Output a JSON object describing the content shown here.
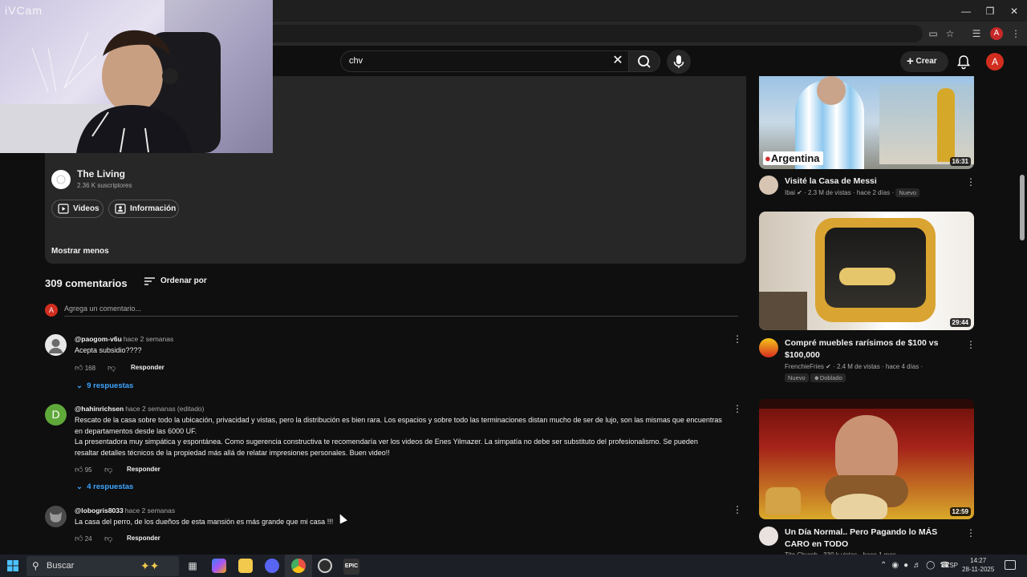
{
  "webcam": {
    "label": "iVCam"
  },
  "browser": {
    "profile_initial": "A"
  },
  "header": {
    "search_value": "chv",
    "create_label": "Crear",
    "avatar_initial": "A"
  },
  "description": {
    "channel_name": "The Living",
    "channel_subs": "2.36 K suscriptores",
    "videos_label": "Videos",
    "info_label": "Información",
    "show_less": "Mostrar menos"
  },
  "comments": {
    "count": "309 comentarios",
    "sort_label": "Ordenar por",
    "my_initial": "A",
    "placeholder": "Agrega un comentario...",
    "items": [
      {
        "author": "@paogom-v6u",
        "time": "hace 2 semanas",
        "text": [
          "Acepta subsidio????"
        ],
        "likes": "168",
        "reply_label": "Responder",
        "replies": "9 respuestas"
      },
      {
        "author": "@hahinrichsen",
        "time": "hace 2 semanas (editado)",
        "avatar_initial": "D",
        "text": [
          "Rescato de la casa sobre todo la ubicación, privacidad y vistas, pero la distribución es bien rara. Los espacios y sobre todo las terminaciones distan mucho de ser de lujo, son las mismas que encuentras",
          "en departamentos desde las 6000 UF.",
          "La presentadora muy simpática y espontánea. Como sugerencia constructiva te recomendaría ver los videos de Enes Yilmazer. La simpatía no debe ser substituto del profesionalismo. Se pueden",
          "resaltar detalles técnicos de la propiedad más allá de relatar impresiones personales. Buen video!!"
        ],
        "likes": "95",
        "reply_label": "Responder",
        "replies": "4 respuestas"
      },
      {
        "author": "@lobogris8033",
        "time": "hace 2 semanas",
        "text": [
          "La casa del perro, de los dueños de esta mansión es más grande que mi casa !!!"
        ],
        "likes": "24",
        "reply_label": "Responder"
      }
    ]
  },
  "sidebar": {
    "videos": [
      {
        "thumb_label": "Argentina",
        "duration": "16:31",
        "title": "Visité la Casa de Messi",
        "channel": "Ibai",
        "views": "2.3 M de vistas",
        "age": "hace 2 días",
        "badge": "Nuevo"
      },
      {
        "duration": "29:44",
        "title": "Compré muebles rarísimos de $100 vs $100,000",
        "channel": "FrenchieFries",
        "views": "2.4 M de vistas",
        "age": "hace 4 días",
        "badge": "Nuevo",
        "badge2": "Doblado"
      },
      {
        "duration": "12:59",
        "title": "Un Día Normal.. Pero Pagando lo MÁS CARO en TODO",
        "channel": "Tito Church",
        "views": "330 k vistas",
        "age": "hace 1 mes"
      }
    ]
  },
  "taskbar": {
    "search_label": "Buscar",
    "lang": "ESP",
    "time": "14:27",
    "date": "28-11-2025"
  }
}
